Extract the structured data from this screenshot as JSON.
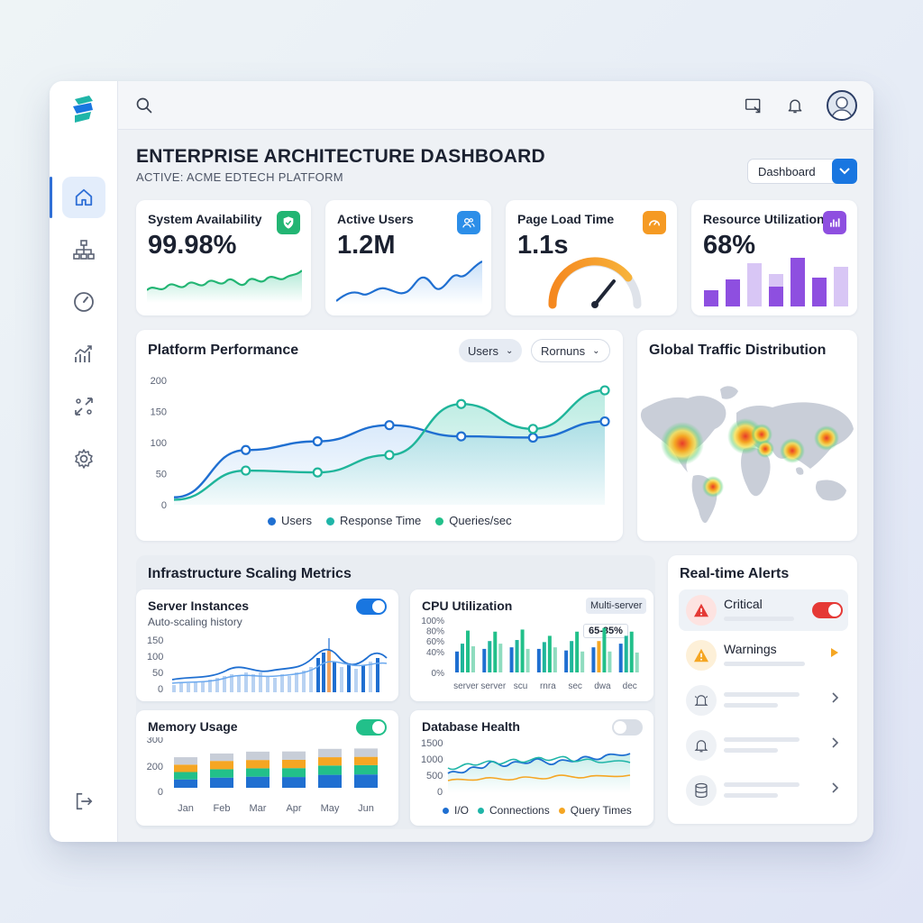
{
  "header": {
    "title": "ENTERPRISE ARCHITECTURE DASHBOARD",
    "subtitle": "ACTIVE: ACME EDTECH PLATFORM",
    "view_select": "Dashboard"
  },
  "sidebar": {
    "items": [
      {
        "name": "home",
        "icon": "home-icon"
      },
      {
        "name": "architecture",
        "icon": "hierarchy-icon"
      },
      {
        "name": "performance",
        "icon": "gauge-icon"
      },
      {
        "name": "analytics",
        "icon": "bar-trend-icon"
      },
      {
        "name": "scaling",
        "icon": "expand-arrows-icon"
      },
      {
        "name": "settings",
        "icon": "gear-icon"
      }
    ],
    "logout_icon": "logout-icon"
  },
  "topbar": {
    "icons": [
      "search-icon",
      "cast-icon",
      "bell-icon",
      "avatar"
    ]
  },
  "kpis": [
    {
      "label": "System Availability",
      "value": "99.98%",
      "badge_color": "#22b573",
      "icon": "shield-check-icon"
    },
    {
      "label": "Active Users",
      "value": "1.2M",
      "badge_color": "#2c8ee8",
      "icon": "users-icon"
    },
    {
      "label": "Page Load Time",
      "value": "1.1s",
      "badge_color": "#f59a23",
      "icon": "speedometer-icon",
      "gauge_fraction": 0.82
    },
    {
      "label": "Resource Utilization",
      "value": "68%",
      "badge_color": "#8e4fe0",
      "icon": "bar-chart-icon"
    }
  ],
  "platform_performance": {
    "title": "Platform Performance",
    "filter_1": "Users",
    "filter_2": "Rornuns",
    "legend": [
      "Users",
      "Response Time",
      "Queries/sec"
    ]
  },
  "global_traffic": {
    "title": "Global Traffic Distribution"
  },
  "infrastructure": {
    "title": "Infrastructure Scaling Metrics",
    "server_instances": {
      "title": "Server Instances",
      "subtitle": "Auto-scaling history",
      "toggle_on": true
    },
    "cpu": {
      "title": "CPU Utilization",
      "badge": "Multi-server",
      "callout": "65-85%"
    },
    "memory": {
      "title": "Memory Usage",
      "toggle_on": true
    },
    "database": {
      "title": "Database Health",
      "toggle_on": false,
      "legend": [
        "I/O",
        "Connections",
        "Query Times"
      ]
    }
  },
  "alerts": {
    "title": "Real-time Alerts",
    "items": [
      {
        "label": "Critical",
        "icon": "warning-triangle-icon",
        "color": "#e53935"
      },
      {
        "label": "Warnings",
        "icon": "warning-triangle-icon",
        "color": "#f5a623"
      }
    ],
    "more_icons": [
      "bell-ring-icon",
      "bell-icon",
      "database-icon"
    ]
  },
  "colors": {
    "primary": "#1976e0",
    "teal": "#1fb5a8",
    "green": "#22c08a",
    "purple": "#8e4fe0",
    "orange": "#f59a23",
    "red": "#e53935"
  },
  "chart_data": [
    {
      "type": "line",
      "id": "platform_performance",
      "x": [
        0,
        1,
        2,
        3,
        4,
        5,
        6
      ],
      "ylim": [
        0,
        200
      ],
      "yticks": [
        "200",
        "150",
        "100",
        "50",
        "0"
      ],
      "series": [
        {
          "name": "Users",
          "values": [
            12,
            88,
            102,
            128,
            110,
            108,
            134
          ]
        },
        {
          "name": "Response Time",
          "values": [
            8,
            55,
            52,
            80,
            162,
            122,
            184
          ]
        }
      ],
      "legend": [
        "Users",
        "Response Time",
        "Queries/sec"
      ]
    },
    {
      "type": "bar",
      "id": "cpu_utilization",
      "categories": [
        "server",
        "server",
        "scu",
        "rnra",
        "sec",
        "dwa",
        "dec"
      ],
      "yticks": [
        "100%",
        "80%",
        "60%",
        "40%",
        "0%"
      ],
      "ylim": [
        0,
        100
      ],
      "series": [
        {
          "name": "blue",
          "values": [
            40,
            45,
            48,
            45,
            42,
            48,
            55
          ]
        },
        {
          "name": "green",
          "values": [
            55,
            60,
            62,
            58,
            60,
            60,
            70
          ]
        },
        {
          "name": "teal",
          "values": [
            80,
            78,
            82,
            70,
            78,
            85,
            78
          ]
        },
        {
          "name": "lightgreen",
          "values": [
            50,
            55,
            45,
            48,
            40,
            40,
            38
          ]
        }
      ]
    },
    {
      "type": "bar",
      "id": "memory_usage",
      "categories": [
        "Jan",
        "Feb",
        "Mar",
        "Apr",
        "May",
        "Jun"
      ],
      "yticks": [
        "300",
        "200",
        "0"
      ],
      "ylim": [
        0,
        300
      ],
      "series": [
        {
          "name": "blue",
          "values": [
            45,
            55,
            60,
            58,
            70,
            72
          ]
        },
        {
          "name": "green",
          "values": [
            40,
            45,
            45,
            48,
            50,
            50
          ]
        },
        {
          "name": "orange",
          "values": [
            40,
            45,
            45,
            45,
            45,
            45
          ]
        },
        {
          "name": "gray",
          "values": [
            40,
            40,
            45,
            45,
            45,
            45
          ]
        }
      ]
    },
    {
      "type": "line",
      "id": "database_health",
      "yticks": [
        "1500",
        "1000",
        "500",
        "0"
      ],
      "ylim": [
        0,
        1500
      ],
      "legend": [
        "I/O",
        "Connections",
        "Query Times"
      ]
    }
  ]
}
